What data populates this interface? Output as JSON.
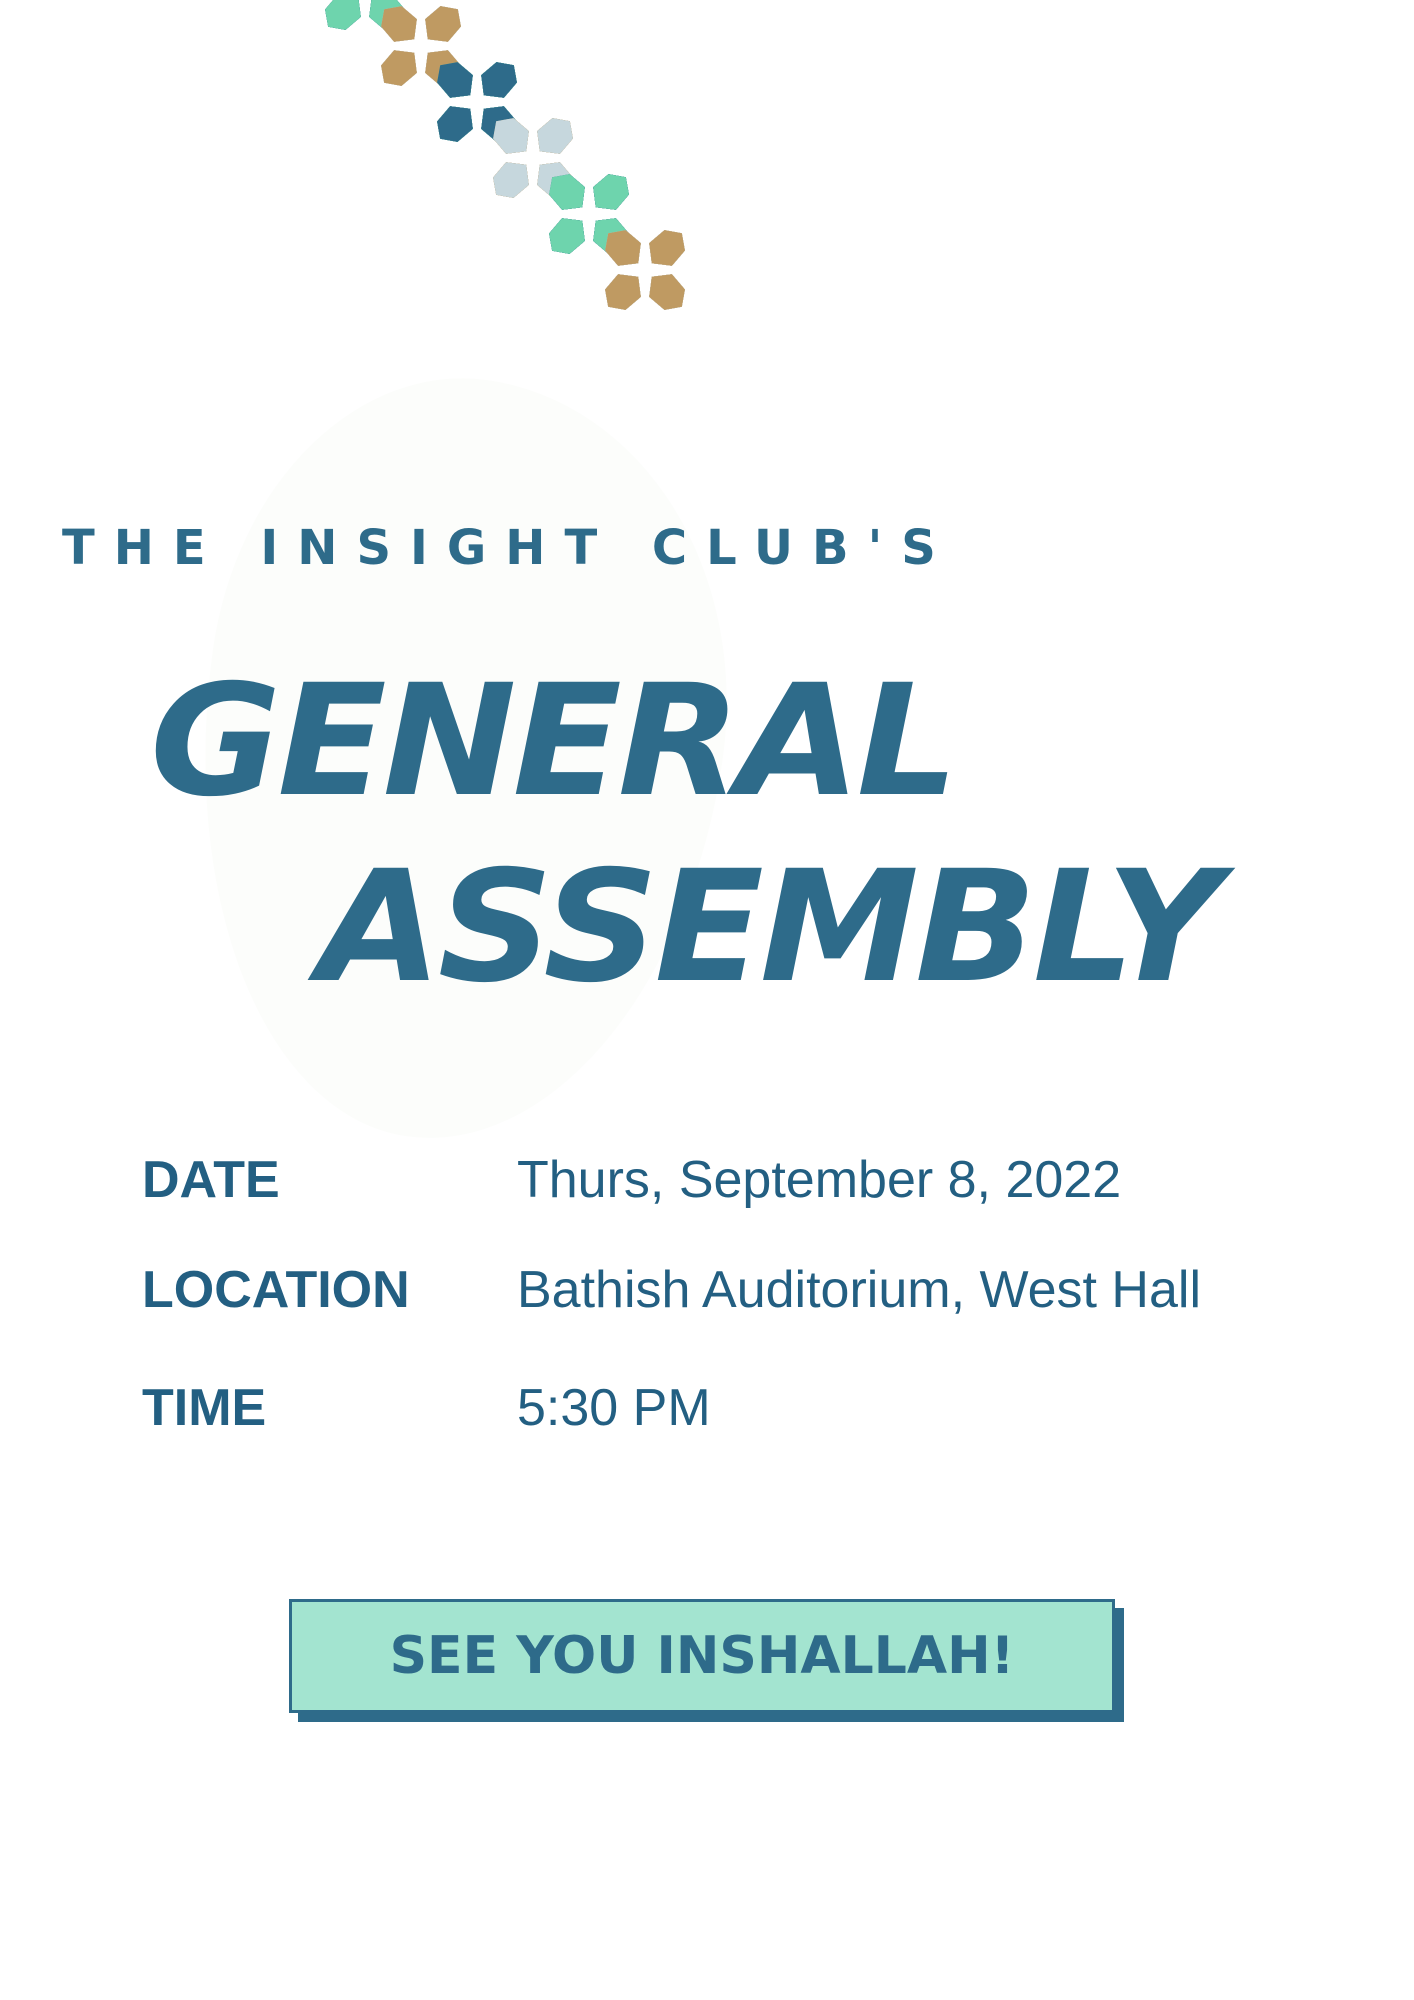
{
  "header": {
    "subtitle": "THE INSIGHT CLUB'S",
    "title_line_1": "GENERAL",
    "title_line_2": "ASSEMBLY"
  },
  "details": {
    "date_label": "DATE",
    "date_value": "Thurs, September 8, 2022",
    "location_label": "LOCATION",
    "location_value": "Bathish Auditorium, West Hall",
    "time_label": "TIME",
    "time_value": "5:30 PM"
  },
  "cta": {
    "label": "SEE YOU INSHALLAH!"
  },
  "decoration": {
    "name": "geometric-tile-pattern",
    "colors": [
      "#2e6b8a",
      "#bf9a62",
      "#6ed4ad",
      "#c6d7dd"
    ]
  },
  "colors": {
    "text_primary": "#2e6b8a",
    "cta_fill": "#a3e4d0",
    "background": "#ffffff"
  }
}
